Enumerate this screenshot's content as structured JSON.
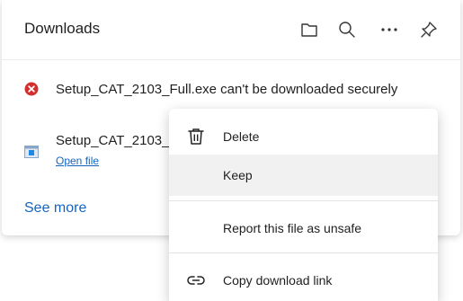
{
  "header": {
    "title": "Downloads",
    "icons": [
      "folder-icon",
      "search-icon",
      "more-options-icon",
      "pin-icon"
    ]
  },
  "downloads": [
    {
      "status": "error",
      "text": "Setup_CAT_2103_Full.exe can't be downloaded securely"
    },
    {
      "status": "file",
      "name": "Setup_CAT_2103_",
      "action": "Open file"
    }
  ],
  "footer": {
    "see_more": "See more"
  },
  "context_menu": {
    "items": [
      {
        "label": "Delete",
        "icon": "trash-icon"
      },
      {
        "label": "Keep",
        "icon": ""
      },
      {
        "label": "Report this file as unsafe",
        "icon": ""
      },
      {
        "label": "Copy download link",
        "icon": "link-icon"
      }
    ]
  },
  "colors": {
    "accent_link": "#1565c0",
    "error_red": "#d32f2f",
    "hover_bg": "#f1f1f1"
  }
}
